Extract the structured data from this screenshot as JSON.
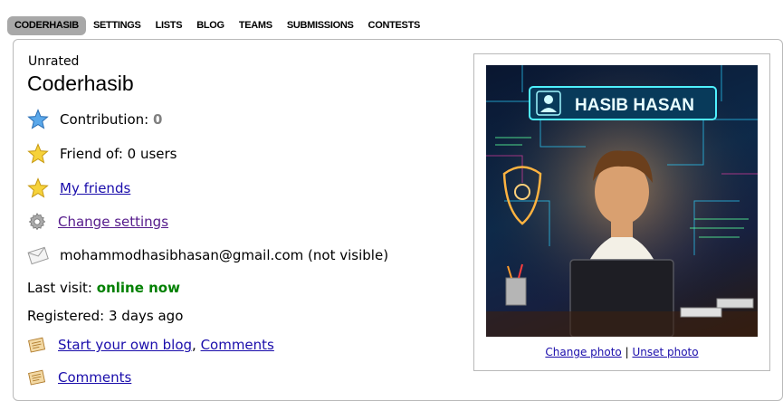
{
  "tabs": [
    "CODERHASIB",
    "SETTINGS",
    "LISTS",
    "BLOG",
    "TEAMS",
    "SUBMISSIONS",
    "CONTESTS"
  ],
  "profile": {
    "rank": "Unrated",
    "handle": "Coderhasib",
    "contribution_label": "Contribution:",
    "contribution_value": "0",
    "friend_of": "Friend of: 0 users",
    "my_friends": "My friends",
    "change_settings": "Change settings",
    "email": "mohammodhasibhasan@gmail.com (not visible)",
    "last_visit_label": "Last visit:",
    "last_visit_value": "online now",
    "registered": "Registered: 3 days ago",
    "blog_link": "Start your own blog",
    "blog_sep": ", ",
    "blog_comments": "Comments",
    "comments": "Comments"
  },
  "photo": {
    "banner_text": "HASIB HASAN",
    "change_photo": "Change photo",
    "separator": " | ",
    "unset_photo": "Unset photo"
  },
  "colors": {
    "tab_active_bg": "#a8a8a8",
    "link": "#1a0dab",
    "online": "#008000",
    "contribution": "#808080"
  }
}
